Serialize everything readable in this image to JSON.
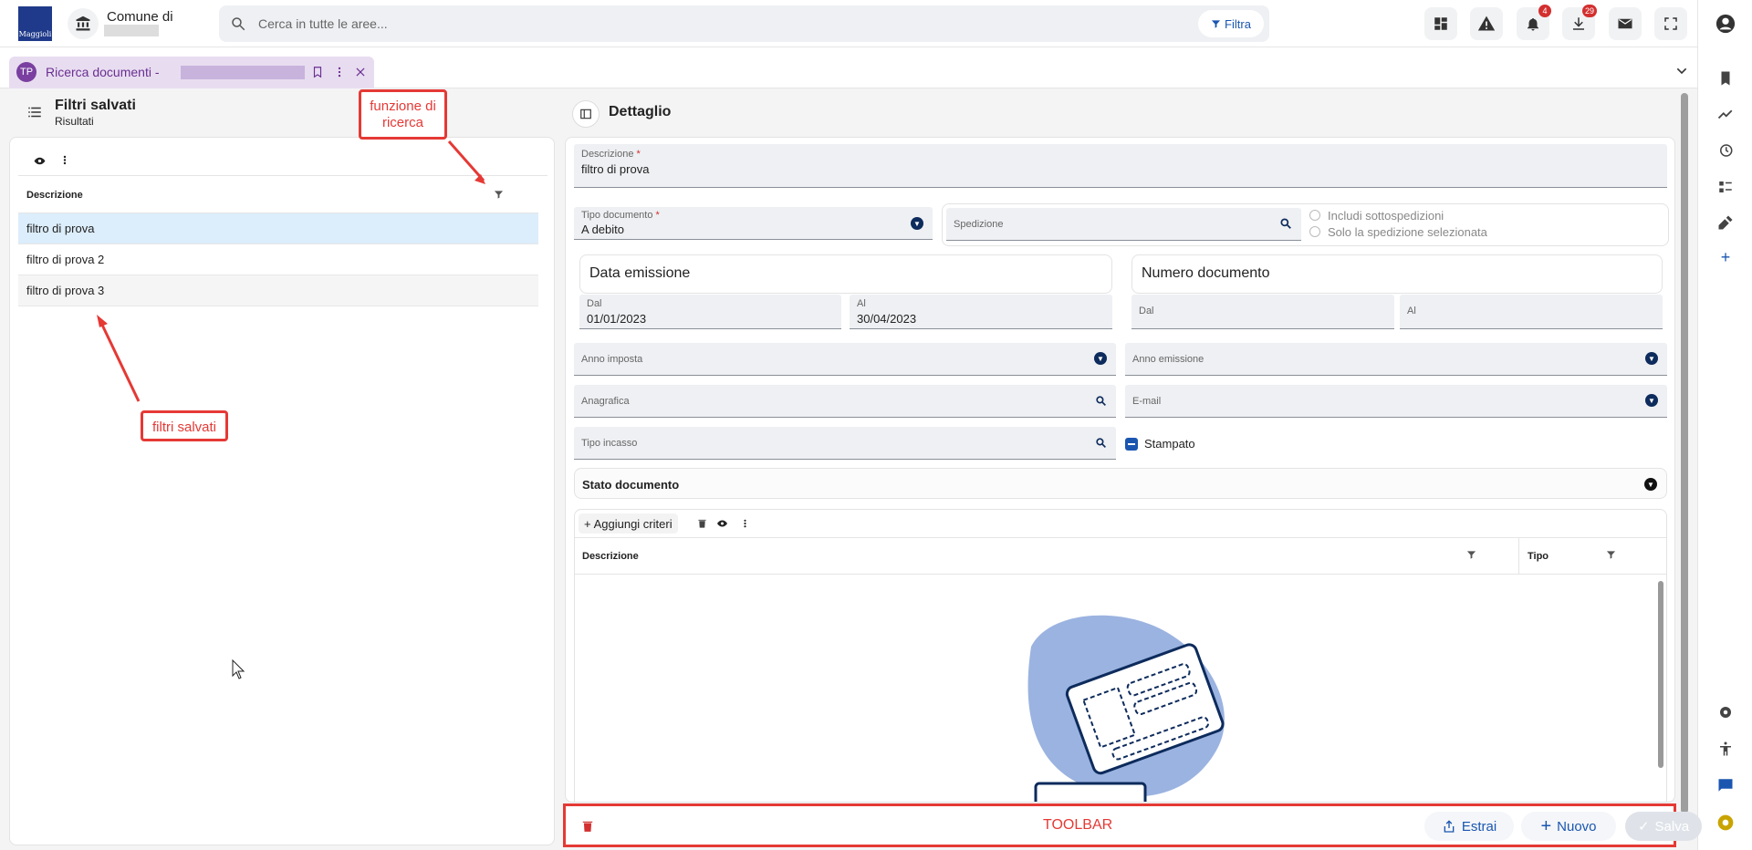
{
  "header": {
    "logo_text": "Maggioli",
    "org_prefix": "Comune di",
    "search_placeholder": "Cerca in tutte le aree...",
    "filter_label": "Filtra",
    "notif_count": "4",
    "download_count": "29"
  },
  "tab": {
    "title": "Ricerca documenti -",
    "icon_text": "TP"
  },
  "left": {
    "title": "Filtri salvati",
    "subtitle": "Risultati",
    "col_header": "Descrizione",
    "rows": [
      "filtro di prova",
      "filtro di prova 2",
      "filtro di prova 3"
    ]
  },
  "annotations": {
    "search_fn": "funzione di ricerca",
    "saved_filters": "filtri salvati",
    "toolbar": "TOOLBAR"
  },
  "detail": {
    "title": "Dettaglio",
    "descrizione_label": "Descrizione",
    "descrizione_value": "filtro di prova",
    "tipo_doc_label": "Tipo documento",
    "tipo_doc_value": "A debito",
    "spedizione_label": "Spedizione",
    "radio1": "Includi sottospedizioni",
    "radio2": "Solo la spedizione selezionata",
    "data_emissione": "Data emissione",
    "numero_documento": "Numero documento",
    "dal_label": "Dal",
    "al_label": "Al",
    "dal_value": "01/01/2023",
    "al_value": "30/04/2023",
    "anno_imposta": "Anno imposta",
    "anno_emissione": "Anno emissione",
    "anagrafica": "Anagrafica",
    "email": "E-mail",
    "tipo_incasso": "Tipo incasso",
    "stampato": "Stampato",
    "stato_documento": "Stato documento",
    "aggiungi_criteri": "Aggiungi criteri",
    "col_descrizione": "Descrizione",
    "col_tipo": "Tipo"
  },
  "toolbar": {
    "estrai": "Estrai",
    "nuovo": "Nuovo",
    "salva": "Salva"
  },
  "colors": {
    "accent": "#1a56b0",
    "brand": "#1f3a8a",
    "tab": "#7a3fa0",
    "annotation": "#e53935",
    "delete": "#d32f2f"
  }
}
